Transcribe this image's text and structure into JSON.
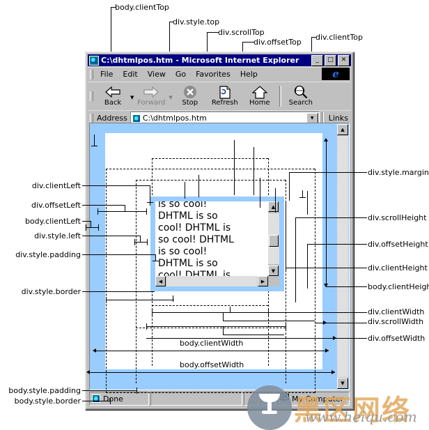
{
  "window": {
    "title": "C:\\dhtmlpos.htm - Microsoft Internet Explorer",
    "minimize_label": "_",
    "maximize_label": "□",
    "close_label": "✕",
    "icon": "ie-document-icon"
  },
  "menu": {
    "items": [
      "File",
      "Edit",
      "View",
      "Go",
      "Favorites",
      "Help"
    ],
    "logo": "e"
  },
  "toolbar": {
    "buttons": [
      {
        "label": "Back",
        "icon": "arrow-left-icon",
        "disabled": false,
        "dropdown": true
      },
      {
        "label": "Forward",
        "icon": "arrow-right-icon",
        "disabled": true,
        "dropdown": true
      },
      {
        "label": "Stop",
        "icon": "stop-icon",
        "disabled": false,
        "dropdown": false
      },
      {
        "label": "Refresh",
        "icon": "refresh-icon",
        "disabled": false,
        "dropdown": false
      },
      {
        "label": "Home",
        "icon": "home-icon",
        "disabled": false,
        "dropdown": false
      },
      {
        "label": "Search",
        "icon": "search-icon",
        "disabled": false,
        "dropdown": false
      }
    ]
  },
  "address_bar": {
    "label": "Address",
    "value": "C:\\dhtmlpos.htm",
    "placeholder": "",
    "dropdown_icon": "chevron-down-icon",
    "links_label": "Links"
  },
  "page": {
    "div_text": "is so cool! DHTML is so cool! DHTML is so cool! DHTML is so cool! DHTML is so cool! DHTML is",
    "div_lines": [
      "is so cool!",
      "DHTML is so",
      "cool! DHTML is",
      "so cool! DHTML",
      "is so cool!",
      "DHTML is so",
      "cool! DHTML is"
    ],
    "body_background": "#99ccff",
    "div_border_color": "#99ccff",
    "scroll_up_icon": "triangle-up-icon",
    "scroll_down_icon": "triangle-down-icon",
    "scroll_left_icon": "triangle-left-icon",
    "scroll_right_icon": "triangle-right-icon"
  },
  "status_bar": {
    "message": "Done",
    "message_icon": "ie-document-icon",
    "zone": "My Computer",
    "zone_icon": "my-computer-icon"
  },
  "annotations": {
    "top": [
      {
        "id": "body-clienttop",
        "text": "body.clientTop"
      },
      {
        "id": "div-styletop",
        "text": "div.style.top"
      },
      {
        "id": "div-scrolltop",
        "text": "div.scrollTop"
      },
      {
        "id": "div-offsettop",
        "text": "div.offsetTop"
      },
      {
        "id": "div-clienttop",
        "text": "div.clientTop"
      }
    ],
    "left": [
      {
        "id": "div-clientleft",
        "text": "div.clientLeft"
      },
      {
        "id": "div-offsetleft",
        "text": "div.offsetLeft"
      },
      {
        "id": "body-clientleft",
        "text": "body.clientLeft"
      },
      {
        "id": "div-styleleft",
        "text": "div.style.left"
      },
      {
        "id": "div-stylepadding",
        "text": "div.style.padding"
      },
      {
        "id": "div-styleborder",
        "text": "div.style.border"
      },
      {
        "id": "body-stylepadding",
        "text": "body.style.padding"
      },
      {
        "id": "body-styleborder",
        "text": "body.style.border"
      }
    ],
    "right": [
      {
        "id": "div-stylemargin",
        "text": "div.style.margin"
      },
      {
        "id": "div-scrollheight",
        "text": "div.scrollHeight"
      },
      {
        "id": "div-offsetheight",
        "text": "div.offsetHeight"
      },
      {
        "id": "div-clientheight",
        "text": "div.clientHeight"
      },
      {
        "id": "body-clientheight",
        "text": "body.clientHeight"
      },
      {
        "id": "div-clientwidth",
        "text": "div.clientWidth"
      },
      {
        "id": "div-scrollwidth",
        "text": "div.scrollWidth"
      },
      {
        "id": "div-offsetwidth",
        "text": "div.offsetWidth"
      }
    ],
    "center": [
      {
        "id": "body-clientwidth",
        "text": "body.clientWidth"
      },
      {
        "id": "body-offsetwidth",
        "text": "body.offsetWidth"
      }
    ]
  },
  "watermark": {
    "text_cn": "黑区网络",
    "text_url": "www.heiqu.com",
    "logo": "cup-logo-icon"
  }
}
